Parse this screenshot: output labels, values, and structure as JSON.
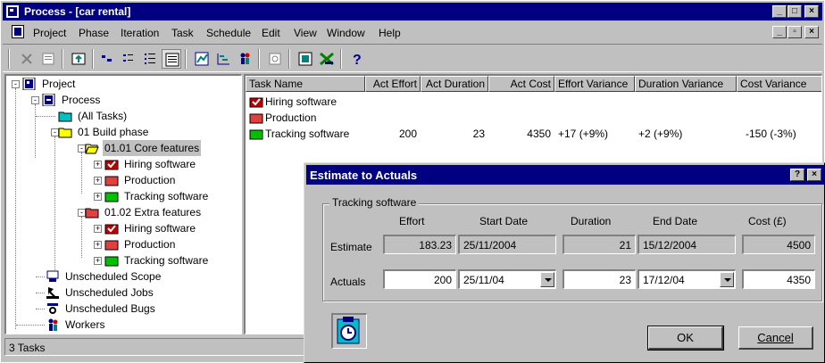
{
  "window": {
    "title": "Process - [car rental]"
  },
  "menu": [
    "Project",
    "Phase",
    "Iteration",
    "Task",
    "Schedule",
    "Edit",
    "View",
    "Window",
    "Help"
  ],
  "tree": {
    "items": [
      {
        "label": "Project",
        "icon": "project-icon"
      },
      {
        "label": "Process",
        "icon": "process-icon"
      },
      {
        "label": "(All Tasks)",
        "icon": "folder-cyan-icon"
      },
      {
        "label": "01 Build phase",
        "icon": "folder-yellow-icon"
      },
      {
        "label": "01.01 Core features",
        "icon": "folder-open-icon"
      },
      {
        "label": "Hiring software",
        "icon": "task-red-check-icon"
      },
      {
        "label": "Production",
        "icon": "task-red-icon"
      },
      {
        "label": "Tracking software",
        "icon": "task-green-icon"
      },
      {
        "label": "01.02 Extra features",
        "icon": "folder-red-icon"
      },
      {
        "label": "Hiring software",
        "icon": "task-red-check-icon"
      },
      {
        "label": "Production",
        "icon": "task-red-icon"
      },
      {
        "label": "Tracking software",
        "icon": "task-green-icon"
      },
      {
        "label": "Unscheduled Scope",
        "icon": "scope-icon"
      },
      {
        "label": "Unscheduled Jobs",
        "icon": "jobs-icon"
      },
      {
        "label": "Unscheduled Bugs",
        "icon": "bugs-icon"
      },
      {
        "label": "Workers",
        "icon": "workers-icon"
      }
    ]
  },
  "table": {
    "columns": [
      "Task Name",
      "Act Effort",
      "Act Duration",
      "Act Cost",
      "Effort Variance",
      "Duration Variance",
      "Cost Variance"
    ],
    "rows": [
      {
        "name": "Hiring software",
        "effort": "",
        "duration": "",
        "cost": "",
        "effort_var": "",
        "duration_var": "",
        "cost_var": ""
      },
      {
        "name": "Production",
        "effort": "",
        "duration": "",
        "cost": "",
        "effort_var": "",
        "duration_var": "",
        "cost_var": ""
      },
      {
        "name": "Tracking software",
        "effort": "200",
        "duration": "23",
        "cost": "4350",
        "effort_var": "+17 (+9%)",
        "duration_var": "+2 (+9%)",
        "cost_var": "-150 (-3%)"
      }
    ]
  },
  "status": {
    "text": "3 Tasks"
  },
  "dialog": {
    "title": "Estimate to Actuals",
    "group_label": "Tracking software",
    "headers": [
      "Effort",
      "Start Date",
      "Duration",
      "End Date",
      "Cost (£)"
    ],
    "estimate": {
      "label": "Estimate",
      "effort": "183.23",
      "start": "25/11/2004",
      "duration": "21",
      "end": "15/12/2004",
      "cost": "4500"
    },
    "actuals": {
      "label": "Actuals",
      "effort": "200",
      "start": "25/11/04",
      "duration": "23",
      "end": "17/12/04",
      "cost": "4350"
    },
    "ok_label": "OK",
    "cancel_label": "Cancel"
  }
}
